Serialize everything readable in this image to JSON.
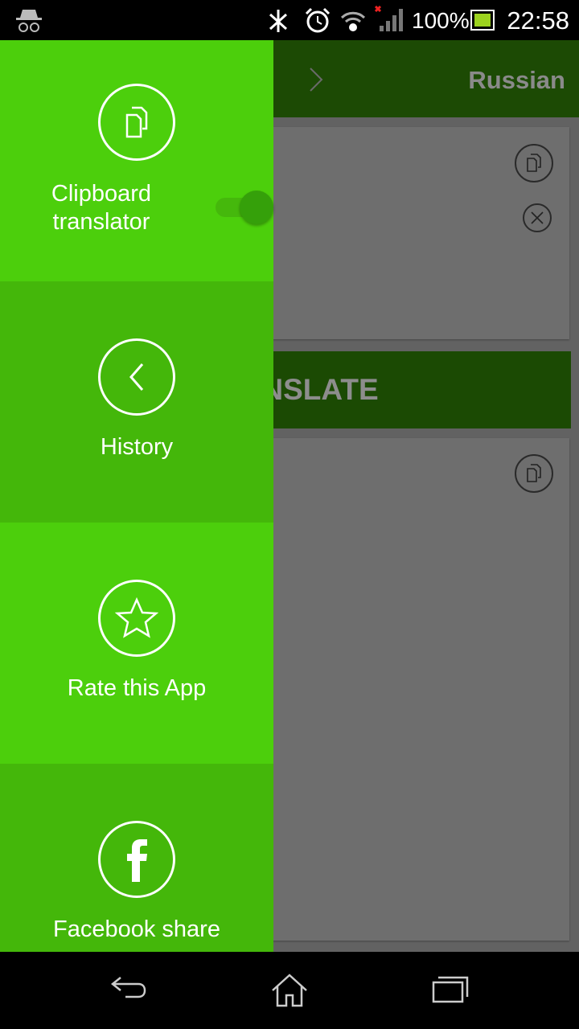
{
  "status_bar": {
    "battery_percent": "100%",
    "time": "22:58",
    "icons": [
      "incognito-icon",
      "bluetooth-off-icon",
      "alarm-icon",
      "wifi-icon",
      "signal-no-data-icon",
      "battery-icon"
    ]
  },
  "header": {
    "target_language": "Russian"
  },
  "main": {
    "translate_label": "TRANSLATE"
  },
  "drawer": {
    "colors": {
      "light": "#4ccf0c",
      "dark": "#44b70a"
    },
    "items": [
      {
        "label": "Clipboard translator",
        "icon": "clipboard-icon",
        "toggle_on": true
      },
      {
        "label": "History",
        "icon": "chevron-left-icon"
      },
      {
        "label": "Rate this App",
        "icon": "star-icon"
      },
      {
        "label": "Facebook share",
        "icon": "facebook-icon"
      }
    ]
  }
}
